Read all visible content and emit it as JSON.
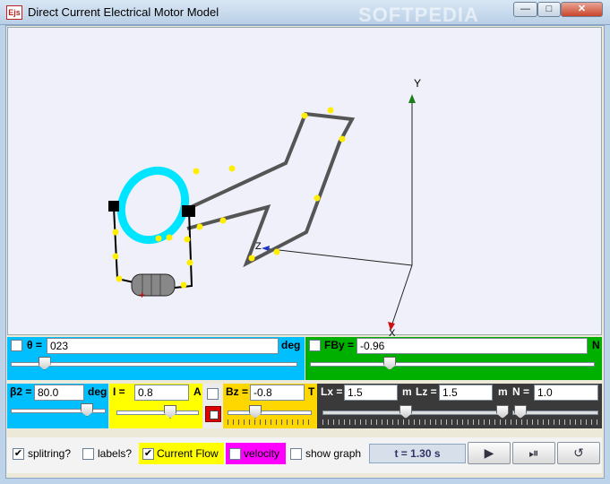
{
  "window": {
    "icon_text": "Ejs",
    "title": "Direct Current Electrical Motor Model",
    "minimize": "—",
    "maximize": "□",
    "close": "✕",
    "watermark": "SOFTPEDIA"
  },
  "view3d": {
    "axis_y": "Y",
    "axis_x": "X",
    "axis_z": "Z"
  },
  "row1": {
    "theta_label": "θ =",
    "theta_value": "023",
    "theta_unit": "deg",
    "theta_slider": 0.1,
    "fby_label": "FBy =",
    "fby_value": "-0.96",
    "fby_unit": "N",
    "fby_slider": 0.27
  },
  "row2": {
    "b2_label": "β2 =",
    "b2_value": "80.0",
    "b2_unit": "deg",
    "b2_slider": 0.85,
    "i_label": "I =",
    "i_value": "0.8",
    "i_unit": "A",
    "i_slider": 0.68,
    "bz_label": "Bz =",
    "bz_value": "-0.8",
    "bz_unit": "T",
    "bz_slider": 0.3,
    "lx_label": "Lx =",
    "lx_value": "1.5",
    "lx_unit": "m",
    "lz_label": "Lz =",
    "lz_value": "1.5",
    "lz_unit": "m",
    "n_label": "N =",
    "n_value": "1.0"
  },
  "bottom": {
    "splitring_label": "splitring?",
    "splitring_checked": true,
    "labels_label": "labels?",
    "labels_checked": false,
    "current_flow_label": "Current Flow",
    "current_flow_checked": true,
    "velocity_label": "velocity",
    "velocity_checked": false,
    "show_graph_label": "show graph",
    "show_graph_checked": false,
    "time_text": "t = 1.30 s",
    "play_icon": "▶",
    "step_icon": "⏯",
    "reset_icon": "↺"
  },
  "colors": {
    "cyan": "#00bfff",
    "green": "#00b000",
    "yellow": "#ffd700",
    "dark": "#3a3a3a",
    "magenta": "#ff00ff"
  }
}
